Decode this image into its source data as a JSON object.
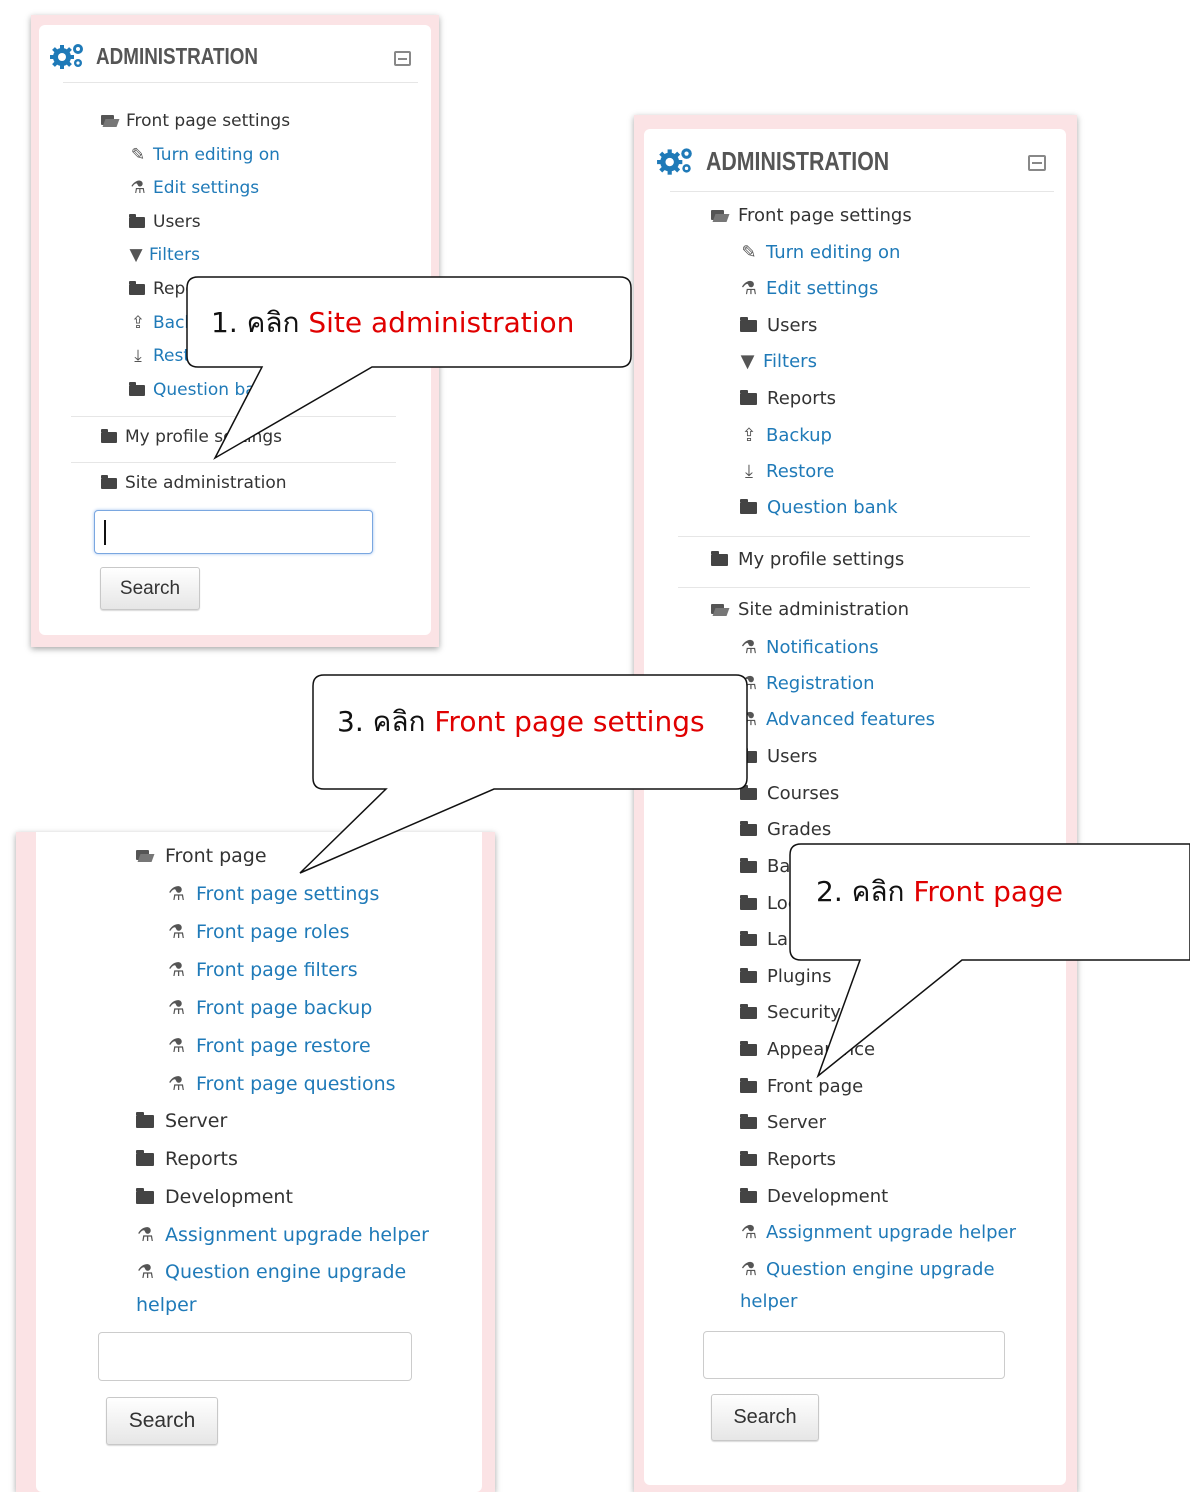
{
  "panel_a": {
    "title": "ADMINISTRATION",
    "items": [
      {
        "label": "Front page settings",
        "icon": "folder-open-icon"
      },
      {
        "label": "Turn editing on",
        "icon": "pencil-icon"
      },
      {
        "label": "Edit settings",
        "icon": "flask-icon"
      },
      {
        "label": "Users",
        "icon": "folder-icon"
      },
      {
        "label": "Filters",
        "icon": "filter-icon"
      },
      {
        "label": "Reports",
        "icon": "folder-icon"
      },
      {
        "label": "Backup",
        "icon": "upload-icon"
      },
      {
        "label": "Restore",
        "icon": "download-icon"
      },
      {
        "label": "Question bank",
        "icon": "folder-icon"
      },
      {
        "label": "My profile settings",
        "icon": "folder-icon"
      },
      {
        "label": "Site administration",
        "icon": "folder-icon"
      }
    ],
    "search_value": "",
    "search_button": "Search"
  },
  "panel_b": {
    "title": "ADMINISTRATION",
    "front_page_settings": {
      "label": "Front page settings",
      "items": [
        "Turn editing on",
        "Edit settings",
        "Users",
        "Filters",
        "Reports",
        "Backup",
        "Restore",
        "Question bank"
      ]
    },
    "my_profile_settings": "My profile settings",
    "site_administration": {
      "label": "Site administration",
      "items": [
        "Notifications",
        "Registration",
        "Advanced features",
        "Users",
        "Courses",
        "Grades",
        "Badges",
        "Location",
        "Language",
        "Plugins",
        "Security",
        "Appearance",
        "Front page",
        "Server",
        "Reports",
        "Development",
        "Assignment upgrade helper",
        "Question engine upgrade",
        "helper"
      ]
    },
    "search_value": "",
    "search_button": "Search"
  },
  "panel_c": {
    "front_page": {
      "label": "Front page",
      "items": [
        "Front page settings",
        "Front page roles",
        "Front page filters",
        "Front page backup",
        "Front page restore",
        "Front page questions"
      ]
    },
    "other_items": [
      "Server",
      "Reports",
      "Development",
      "Assignment upgrade helper",
      "Question engine upgrade",
      "helper"
    ],
    "search_value": "",
    "search_button": "Search"
  },
  "callouts": [
    {
      "prefix": "1. คลิก ",
      "highlight": "Site administration"
    },
    {
      "prefix": "2. คลิก ",
      "highlight": "Front page"
    },
    {
      "prefix": "3. คลิก ",
      "highlight": "Front page settings"
    }
  ],
  "colors": {
    "link": "#1f7ab8",
    "highlight": "#e00000",
    "panel_border": "#fbe3e5",
    "text": "#333333"
  }
}
